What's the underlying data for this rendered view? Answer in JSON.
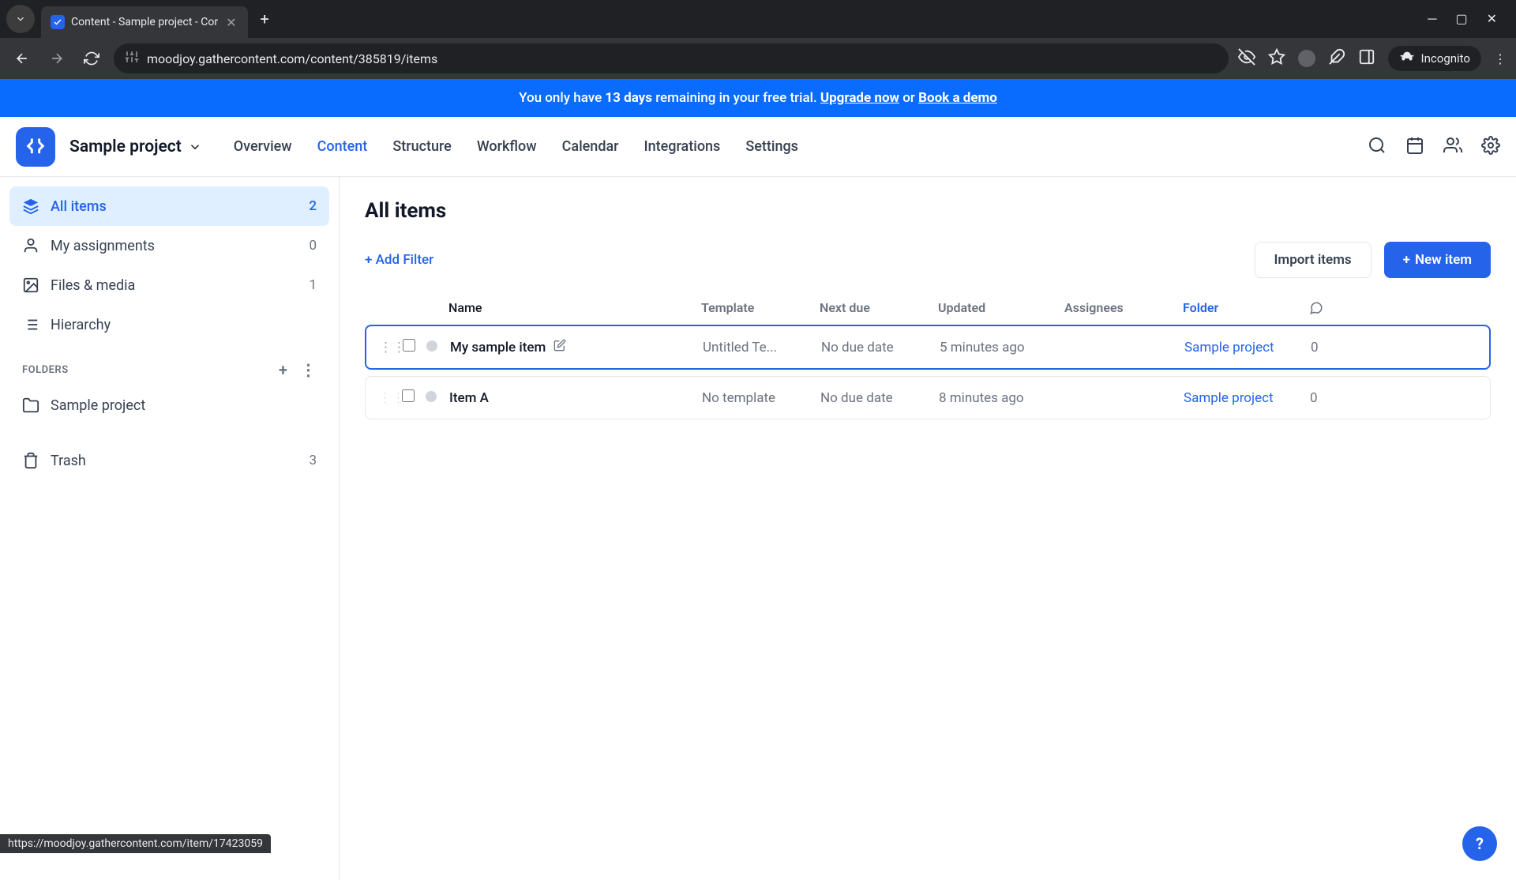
{
  "browser": {
    "tab_title": "Content - Sample project - Cor",
    "url": "moodjoy.gathercontent.com/content/385819/items",
    "incognito_label": "Incognito",
    "status_url": "https://moodjoy.gathercontent.com/item/17423059"
  },
  "trial_banner": {
    "prefix": "You only have ",
    "days": "13 days",
    "middle": " remaining in your free trial. ",
    "upgrade": "Upgrade now",
    "or": " or ",
    "book": "Book a demo"
  },
  "header": {
    "project_name": "Sample project",
    "nav": [
      "Overview",
      "Content",
      "Structure",
      "Workflow",
      "Calendar",
      "Integrations",
      "Settings"
    ],
    "active_nav": "Content"
  },
  "sidebar": {
    "items": [
      {
        "label": "All items",
        "count": "2",
        "icon": "layers"
      },
      {
        "label": "My assignments",
        "count": "0",
        "icon": "person"
      },
      {
        "label": "Files & media",
        "count": "1",
        "icon": "image"
      },
      {
        "label": "Hierarchy",
        "count": "",
        "icon": "list"
      }
    ],
    "folders_label": "FOLDERS",
    "folders": [
      {
        "label": "Sample project"
      }
    ],
    "trash": {
      "label": "Trash",
      "count": "3"
    }
  },
  "content": {
    "title": "All items",
    "add_filter": "+ Add Filter",
    "import_btn": "Import items",
    "new_item_btn": "New item",
    "columns": [
      "Name",
      "Template",
      "Next due",
      "Updated",
      "Assignees",
      "Folder"
    ],
    "rows": [
      {
        "name": "My sample item",
        "template": "Untitled Te...",
        "nextdue": "No due date",
        "updated": "5 minutes ago",
        "folder": "Sample project",
        "comments": "0",
        "hovered": true
      },
      {
        "name": "Item A",
        "template": "No template",
        "nextdue": "No due date",
        "updated": "8 minutes ago",
        "folder": "Sample project",
        "comments": "0",
        "hovered": false
      }
    ]
  }
}
